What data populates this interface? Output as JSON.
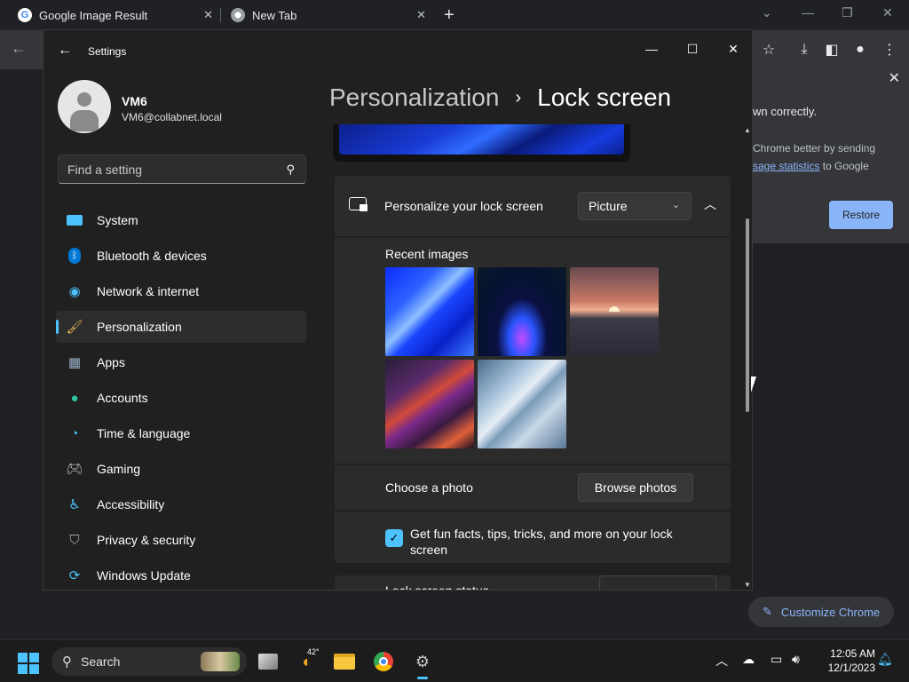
{
  "chrome": {
    "tabs": [
      {
        "title": "Google Image Result",
        "favicon": "google-icon"
      },
      {
        "title": "New Tab",
        "favicon": "chrome-icon"
      }
    ],
    "info_card": {
      "line1": "wn correctly.",
      "line2": "Chrome better by sending",
      "line3_link": "sage statistics",
      "line3_suffix": " to Google",
      "restore_label": "Restore"
    },
    "customize_label": "Customize Chrome"
  },
  "settings": {
    "title": "Settings",
    "profile": {
      "name": "VM6",
      "email": "VM6@collabnet.local"
    },
    "search_placeholder": "Find a setting",
    "nav": [
      {
        "label": "System",
        "icon": "system-icon"
      },
      {
        "label": "Bluetooth & devices",
        "icon": "bluetooth-icon"
      },
      {
        "label": "Network & internet",
        "icon": "wifi-icon"
      },
      {
        "label": "Personalization",
        "icon": "brush-icon",
        "active": true
      },
      {
        "label": "Apps",
        "icon": "apps-icon"
      },
      {
        "label": "Accounts",
        "icon": "accounts-icon"
      },
      {
        "label": "Time & language",
        "icon": "globe-clock-icon"
      },
      {
        "label": "Gaming",
        "icon": "gamepad-icon"
      },
      {
        "label": "Accessibility",
        "icon": "accessibility-icon"
      },
      {
        "label": "Privacy & security",
        "icon": "shield-icon"
      },
      {
        "label": "Windows Update",
        "icon": "update-icon"
      }
    ],
    "breadcrumb": {
      "parent": "Personalization",
      "current": "Lock screen"
    },
    "personalize": {
      "title": "Personalize your lock screen",
      "value": "Picture"
    },
    "recent_images_label": "Recent images",
    "choose_photo_label": "Choose a photo",
    "browse_photos_label": "Browse photos",
    "fun_facts_label": "Get fun facts, tips, tricks, and more on your lock screen",
    "fun_facts_checked": true,
    "lock_status_label": "Lock screen status"
  },
  "taskbar": {
    "search_label": "Search",
    "weather_temp": "42°",
    "time": "12:05 AM",
    "date": "12/1/2023"
  },
  "colors": {
    "accent": "#4cc2ff",
    "chrome_link": "#8ab4f8",
    "settings_bg": "#202020",
    "card_bg": "#2b2b2b"
  }
}
